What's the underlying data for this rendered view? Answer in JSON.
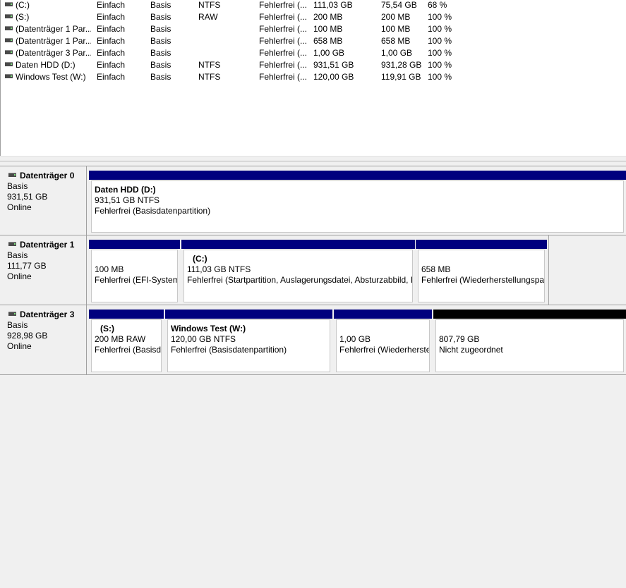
{
  "volumes": [
    {
      "name": "(C:)",
      "layout": "Einfach",
      "type": "Basis",
      "fs": "NTFS",
      "status": "Fehlerfrei (...",
      "capacity": "111,03 GB",
      "free": "75,54 GB",
      "pct": "68 %"
    },
    {
      "name": "(S:)",
      "layout": "Einfach",
      "type": "Basis",
      "fs": "RAW",
      "status": "Fehlerfrei (...",
      "capacity": "200 MB",
      "free": "200 MB",
      "pct": "100 %"
    },
    {
      "name": "(Datenträger 1 Par...",
      "layout": "Einfach",
      "type": "Basis",
      "fs": "",
      "status": "Fehlerfrei (...",
      "capacity": "100 MB",
      "free": "100 MB",
      "pct": "100 %"
    },
    {
      "name": "(Datenträger 1 Par...",
      "layout": "Einfach",
      "type": "Basis",
      "fs": "",
      "status": "Fehlerfrei (...",
      "capacity": "658 MB",
      "free": "658 MB",
      "pct": "100 %"
    },
    {
      "name": "(Datenträger 3 Par...",
      "layout": "Einfach",
      "type": "Basis",
      "fs": "",
      "status": "Fehlerfrei (...",
      "capacity": "1,00 GB",
      "free": "1,00 GB",
      "pct": "100 %"
    },
    {
      "name": "Daten HDD (D:)",
      "layout": "Einfach",
      "type": "Basis",
      "fs": "NTFS",
      "status": "Fehlerfrei (...",
      "capacity": "931,51 GB",
      "free": "931,28 GB",
      "pct": "100 %"
    },
    {
      "name": "Windows Test (W:)",
      "layout": "Einfach",
      "type": "Basis",
      "fs": "NTFS",
      "status": "Fehlerfrei (...",
      "capacity": "120,00 GB",
      "free": "119,91 GB",
      "pct": "100 %"
    }
  ],
  "disks": [
    {
      "title": "Datenträger 0",
      "type": "Basis",
      "size": "931,51 GB",
      "state": "Online",
      "partitions": [
        {
          "name": "Daten HDD  (D:)",
          "detail": "931,51 GB NTFS",
          "status": "Fehlerfrei (Basisdatenpartition)"
        }
      ]
    },
    {
      "title": "Datenträger 1",
      "type": "Basis",
      "size": "111,77 GB",
      "state": "Online",
      "partitions": [
        {
          "name": "",
          "detail": "100 MB",
          "status": "Fehlerfrei (EFI-Systempartition)"
        },
        {
          "name": "(C:)",
          "detail": "111,03 GB NTFS",
          "status": "Fehlerfrei (Startpartition, Auslagerungsdatei, Absturzabbild, Primäre Partition)"
        },
        {
          "name": "",
          "detail": "658 MB",
          "status": "Fehlerfrei (Wiederherstellungspartition)"
        }
      ]
    },
    {
      "title": "Datenträger 3",
      "type": "Basis",
      "size": "928,98 GB",
      "state": "Online",
      "partitions": [
        {
          "name": "(S:)",
          "detail": "200 MB RAW",
          "status": "Fehlerfrei (Basisdatenpartition)"
        },
        {
          "name": "Windows Test  (W:)",
          "detail": "120,00 GB NTFS",
          "status": "Fehlerfrei (Basisdatenpartition)"
        },
        {
          "name": "",
          "detail": "1,00 GB",
          "status": "Fehlerfrei (Wiederherstellungspartition)"
        },
        {
          "name": "",
          "detail": "807,79 GB",
          "status": "Nicht zugeordnet"
        }
      ]
    }
  ],
  "colors": {
    "primary_partition": "#00007e",
    "unallocated": "#000000"
  }
}
